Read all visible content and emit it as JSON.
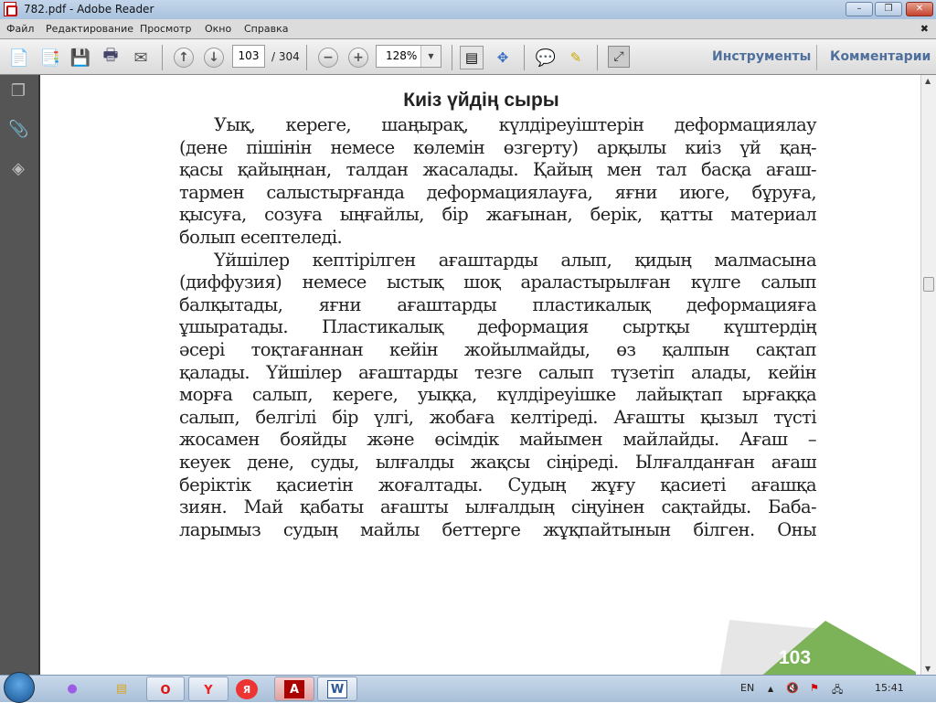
{
  "window": {
    "title": "782.pdf - Adobe Reader",
    "minimize": "–",
    "restore": "❐",
    "close": "✕"
  },
  "menu": [
    "Файл",
    "Редактирование",
    "Просмотр",
    "Окно",
    "Справка"
  ],
  "menu_close": "✖",
  "toolbar": {
    "page_current": "103",
    "page_total": "/ 304",
    "zoom": "128%",
    "tools_label": "Инструменты",
    "comments_label": "Комментарии"
  },
  "document": {
    "title": "Киіз үйдің сыры",
    "lines": [
      "Уық, кереге, шаңырақ, күлдіреуіштерін деформациялау",
      "(дене пішінін немесе көлемін өзгерту) арқылы киіз үй қаң-",
      "қасы қайыңнан, талдан жасалады. Қайың мен тал басқа ағаш-",
      "тармен салыстырғанда деформациялауға, яғни июге, бұруға,",
      "қысуға, созуға ыңғайлы, бір жағынан, берік, қатты материал",
      "болып есептеледі.",
      "Үйшілер кептірілген ағаштарды алып, қидың малмасына",
      "(диффузия) немесе ыстық шоқ араластырылған күлге салып",
      "балқытады, яғни ағаштарды пластикалық деформацияға",
      "ұшыратады. Пластикалық деформация сыртқы күштердің",
      "әсері тоқтағаннан кейін жойылмайды, өз қалпын сақтап",
      "қалады. Үйшілер ағаштарды тезге салып түзетіп алады, кейін",
      "морға салып, кереге, уыққа, күлдіреуішке лайықтап ырғаққа",
      "салып, белгілі бір үлгі, жобаға келтіреді. Ағашты қызыл түсті",
      "жосамен бояйды және өсімдік майымен майлайды. Ағаш –",
      "кеуек дене, суды, ылғалды жақсы сіңіреді. Ылғалданған ағаш",
      "беріктік қасиетін жоғалтады. Судың жұғу қасиеті ағашқа",
      "зиян. Май қабаты ағашты ылғалдың сіңуінен сақтайды. Баба-",
      "ларымыз судың майлы беттерге жұқпайтынын білген. Оны"
    ],
    "page_number": "103"
  },
  "taskbar": {
    "lang": "EN",
    "clock": "15:41",
    "tray_arrow": "▲"
  },
  "colors": {
    "accent": "#4f6f9c",
    "page_green": "#7cb358"
  }
}
